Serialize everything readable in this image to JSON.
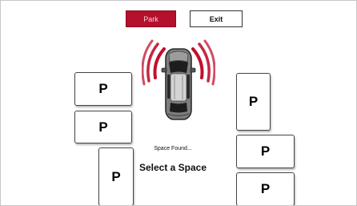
{
  "top_bar": {
    "park_label": "Park",
    "exit_label": "Exit"
  },
  "spaces": {
    "left": [
      "P",
      "P",
      "P"
    ],
    "right": [
      "P",
      "P",
      "P"
    ]
  },
  "status": {
    "message": "Space Found...",
    "prompt": "Select a Space"
  },
  "colors": {
    "accent": "#b5102c",
    "sensor_wave": "#c0102e",
    "background": "#ffffff"
  },
  "icons": {
    "center": "car-top-view-icon"
  }
}
